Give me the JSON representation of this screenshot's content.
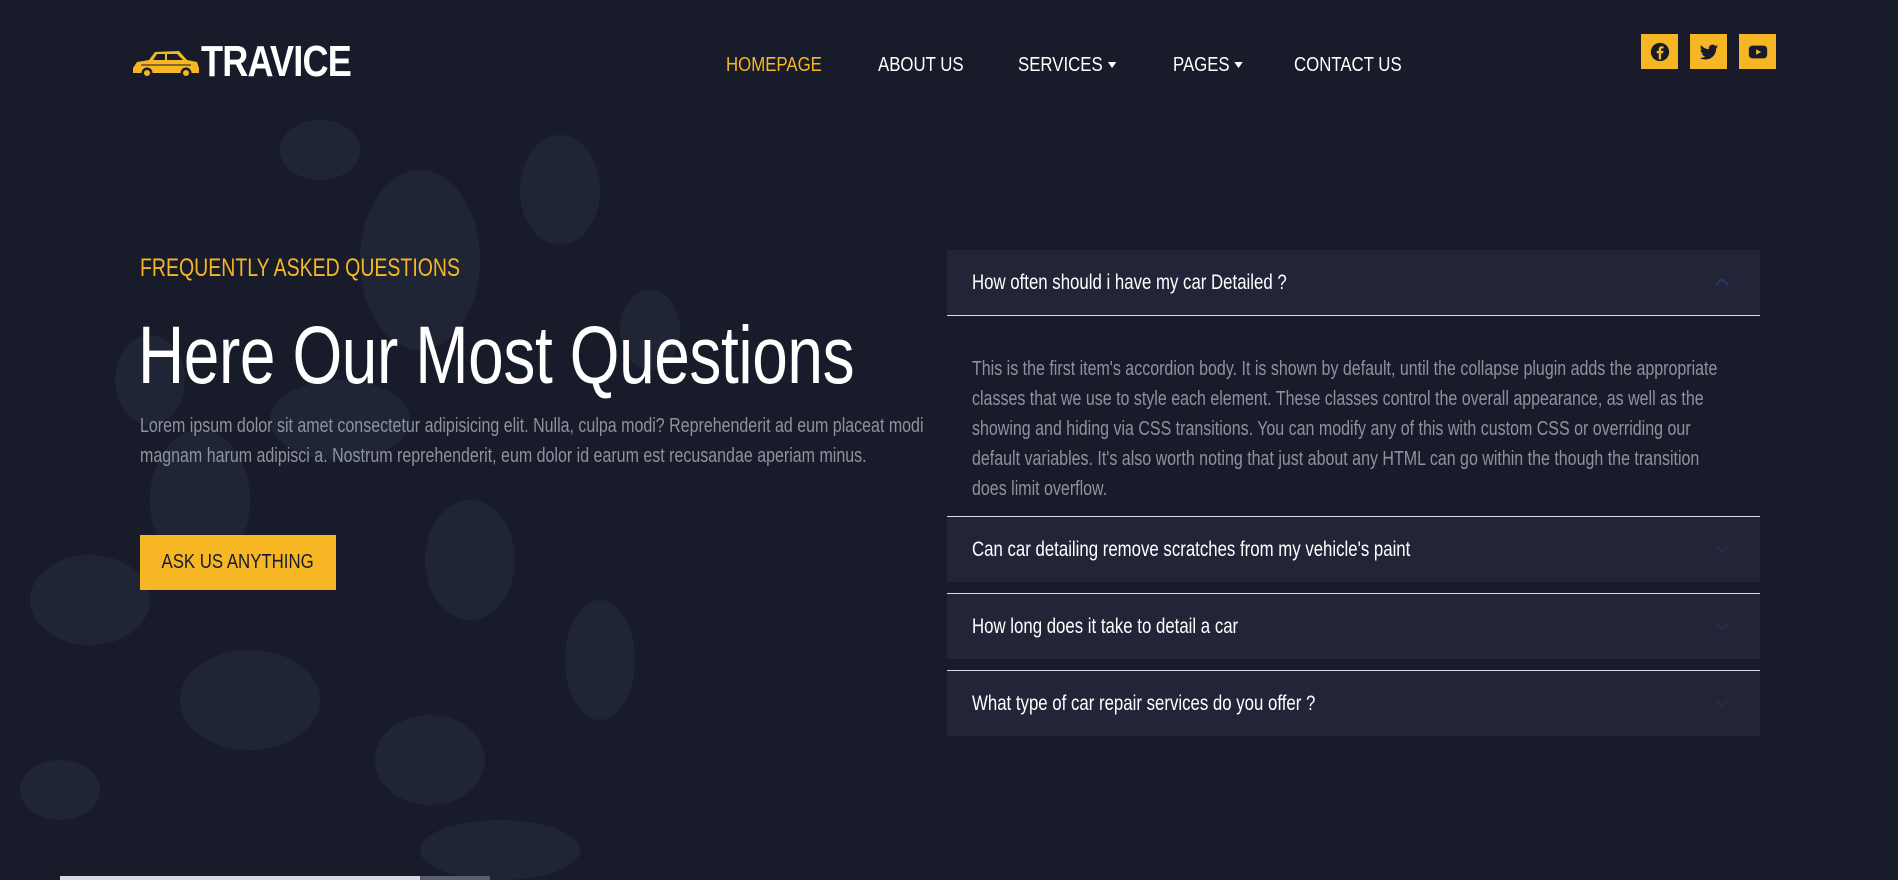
{
  "brand": {
    "name": "TRAVICE",
    "accent_color": "#f7b624",
    "background_color": "#181b29"
  },
  "nav": {
    "items": [
      {
        "label": "HOMEPAGE",
        "active": true,
        "dropdown": false
      },
      {
        "label": "ABOUT US",
        "active": false,
        "dropdown": false
      },
      {
        "label": "SERVICES",
        "active": false,
        "dropdown": true
      },
      {
        "label": "PAGES",
        "active": false,
        "dropdown": true
      },
      {
        "label": "CONTACT US",
        "active": false,
        "dropdown": false
      }
    ]
  },
  "socials": [
    {
      "icon": "facebook-icon"
    },
    {
      "icon": "twitter-icon"
    },
    {
      "icon": "youtube-icon"
    }
  ],
  "hero": {
    "eyebrow": "FREQUENTLY ASKED QUESTIONS",
    "headline": "Here Our Most Questions",
    "lead": "Lorem ipsum dolor sit amet consectetur adipisicing elit. Nulla, culpa modi? Reprehenderit ad eum placeat modi magnam harum adipisci a. Nostrum reprehenderit, eum dolor id earum est recusandae aperiam minus.",
    "cta_label": "ASK US ANYTHING"
  },
  "faq": {
    "items": [
      {
        "question": "How often should i have my car Detailed ?",
        "expanded": true,
        "answer": "This is the first item's accordion body. It is shown by default, until the collapse plugin adds the appropriate classes that we use to style each element. These classes control the overall appearance, as well as the showing and hiding via CSS transitions. You can modify any of this with custom CSS or overriding our default variables. It's also worth noting that just about any HTML can go within the though the transition does limit overflow."
      },
      {
        "question": "Can car detailing remove scratches from my vehicle's paint",
        "expanded": false
      },
      {
        "question": "How long does it take to detail a car",
        "expanded": false
      },
      {
        "question": "What type of car repair services do you offer ?",
        "expanded": false
      }
    ]
  }
}
